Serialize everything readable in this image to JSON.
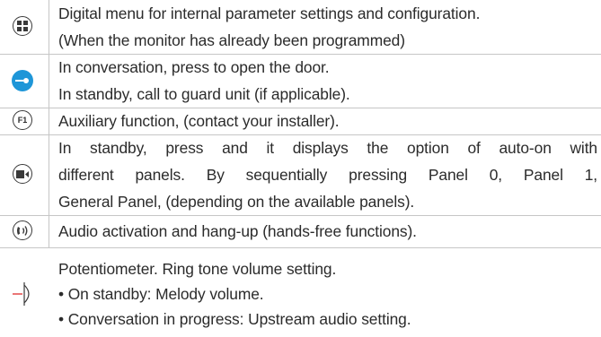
{
  "rows": [
    {
      "icon": "digital-menu-icon",
      "lines": [
        "Digital menu for internal parameter settings and configuration.",
        "(When the monitor has already been programmed)"
      ]
    },
    {
      "icon": "door-key-icon",
      "lines": [
        "In conversation, press to open the door.",
        "In standby, call to guard unit (if applicable)."
      ]
    },
    {
      "icon": "f1-icon",
      "icon_text": "F1",
      "lines": [
        "Auxiliary function, (contact your installer)."
      ]
    },
    {
      "icon": "camera-auto-on-icon",
      "lines": [
        "In standby, press and it displays the option of auto-on with",
        "different panels. By sequentially pressing Panel 0, Panel 1,",
        "General Panel, (depending on the available panels)."
      ]
    },
    {
      "icon": "hands-free-audio-icon",
      "lines": [
        "Audio activation and hang-up (hands-free functions)."
      ]
    },
    {
      "icon": "potentiometer-icon",
      "lines": [
        "Potentiometer. Ring tone volume setting.",
        "• On standby: Melody volume.",
        "• Conversation in progress: Upstream audio setting."
      ]
    }
  ],
  "colors": {
    "text": "#2b2b2b",
    "border": "#c6c6c6",
    "accent_blue": "#1e96d8",
    "accent_red": "#e03a3a"
  }
}
